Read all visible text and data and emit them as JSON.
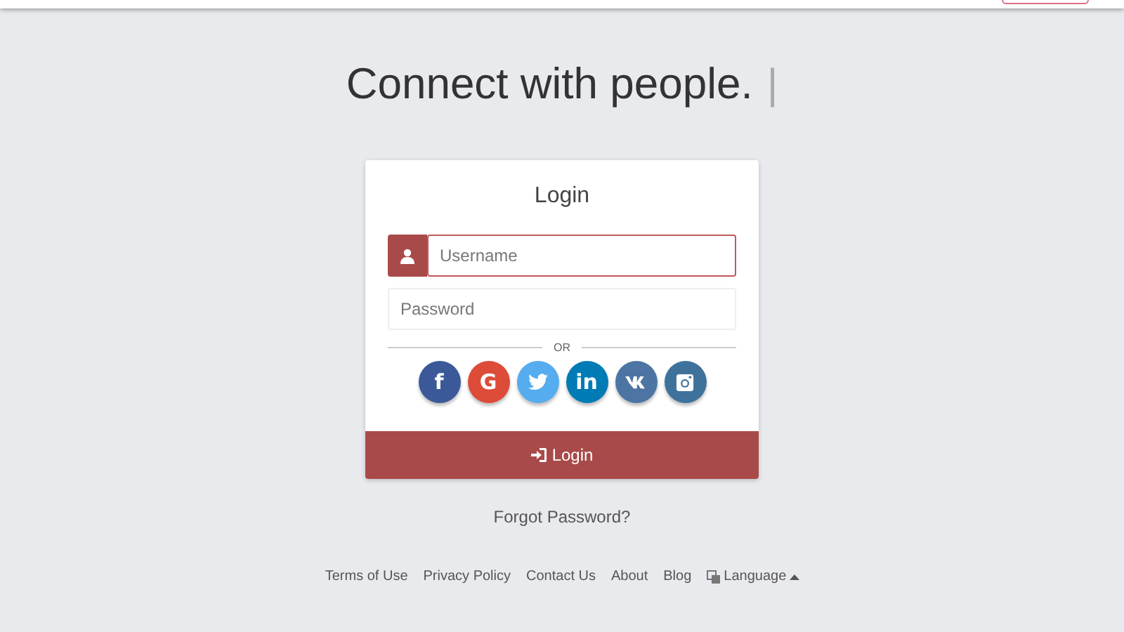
{
  "headline": {
    "text": "Connect with people.",
    "cursor": "|"
  },
  "login_card": {
    "title": "Login",
    "fields": [
      {
        "kind": "username",
        "placeholder": "Username",
        "focused": true
      },
      {
        "kind": "password",
        "placeholder": "Password",
        "focused": false
      }
    ],
    "divider_text": "OR",
    "social_buttons": [
      {
        "kind": "facebook",
        "glyph": "f",
        "color": "#3b5998"
      },
      {
        "kind": "google",
        "glyph": "G",
        "color": "#dd4b39"
      },
      {
        "kind": "twitter",
        "color": "#55acee"
      },
      {
        "kind": "linkedin",
        "glyph": "in",
        "color": "#007bb5"
      },
      {
        "kind": "vk",
        "color": "#4c75a3"
      },
      {
        "kind": "instagram",
        "color": "#3f729b"
      }
    ],
    "submit_button": "Login"
  },
  "forgot_password": "Forgot Password?",
  "footer_links": [
    {
      "kind": "link",
      "label": "Terms of Use"
    },
    {
      "kind": "link",
      "label": "Privacy Policy"
    },
    {
      "kind": "link",
      "label": "Contact Us"
    },
    {
      "kind": "link",
      "label": "About"
    },
    {
      "kind": "link",
      "label": "Blog"
    },
    {
      "kind": "language",
      "label": "Language"
    }
  ]
}
